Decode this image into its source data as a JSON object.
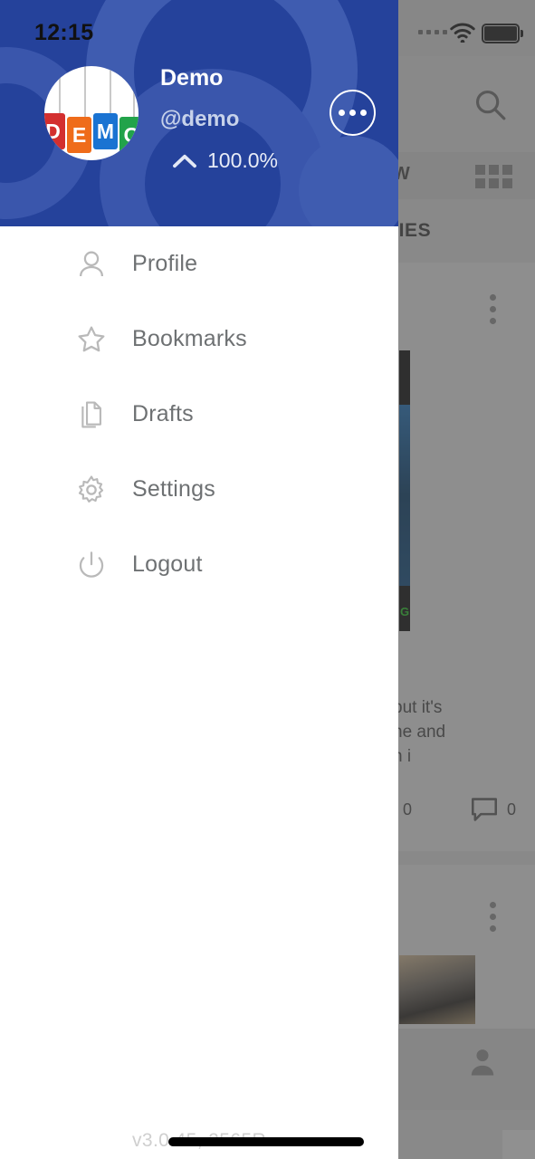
{
  "status_bar": {
    "time": "12:15",
    "signal_icon": "signal-dots-icon",
    "wifi_icon": "wifi-icon",
    "battery_icon": "battery-icon"
  },
  "drawer": {
    "profile": {
      "display_name": "Demo",
      "handle": "@demo",
      "stat_value": "100.0%",
      "stat_direction_icon": "chevron-up-icon",
      "avatar_icon": "demo-letters-avatar",
      "avatar_letters": [
        "D",
        "E",
        "M",
        "O"
      ],
      "avatar_colors": [
        "#d32f2f",
        "#ef6c1a",
        "#1a73d2",
        "#22a34a"
      ],
      "more_button_label": "",
      "more_button_icon": "ellipsis-icon"
    },
    "menu_items": [
      {
        "label": "Profile",
        "icon": "person-icon"
      },
      {
        "label": "Bookmarks",
        "icon": "star-icon"
      },
      {
        "label": "Drafts",
        "icon": "documents-icon"
      },
      {
        "label": "Settings",
        "icon": "gear-icon"
      },
      {
        "label": "Logout",
        "icon": "power-icon"
      }
    ],
    "version": "v3.0.45, 2565R"
  },
  "background_app": {
    "search_icon": "search-icon",
    "tab_label": "EW",
    "grid_icon": "grid-icon",
    "section_title": "NITIES",
    "post": {
      "kebab_icon": "kebab-menu-icon",
      "text": "but it's\nne and\nn i",
      "thumbnail_badge": "G!",
      "like_count": "0",
      "comment_count": "0",
      "comment_icon": "comment-icon"
    },
    "post_2": {
      "kebab_icon": "kebab-menu-icon"
    },
    "tabbar_profile_icon": "person-filled-icon"
  },
  "colors": {
    "header_blue": "#25429b",
    "header_blue_light": "#3f5cb0",
    "menu_text": "#6e7173",
    "menu_icon": "#b9b9b9",
    "dim_overlay": "#484848"
  }
}
